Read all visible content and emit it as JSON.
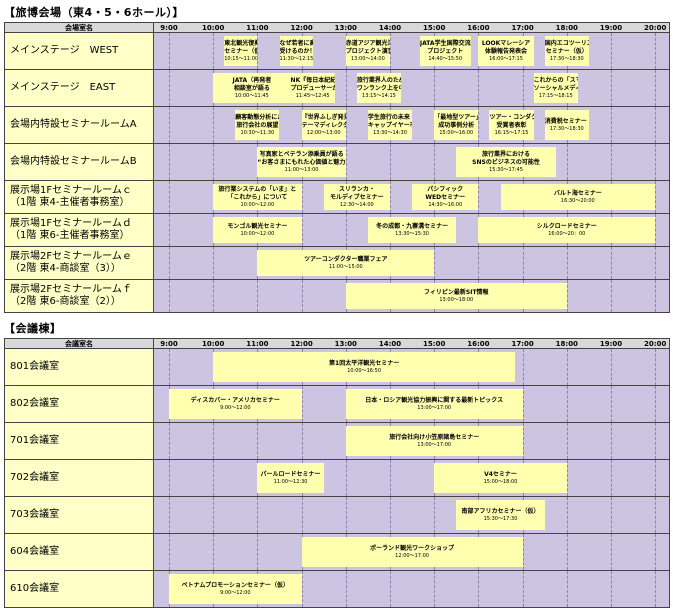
{
  "sections": [
    {
      "title": "【旅博会場（東4・5・6ホール）】",
      "header_label": "会場室名",
      "hours": [
        "9:00",
        "10:00",
        "11:00",
        "12:00",
        "13:00",
        "14:00",
        "15:00",
        "16:00",
        "17:00",
        "18:00",
        "19:00",
        "20:00"
      ],
      "rows": [
        {
          "room": "メインステージ　WEST",
          "events": [
            {
              "title": "東北観光復興\nセミナー（仮）",
              "time": "10:15～11:00",
              "start": 10.25,
              "end": 11.0
            },
            {
              "title": "なぜ若者に高速バスが\n受けるのか！",
              "time": "11:30～12:15",
              "start": 11.5,
              "end": 12.25
            },
            {
              "title": "赤道アジア観光活性化\nプロジェクト演習発表",
              "time": "13:00～14:00",
              "start": 13.0,
              "end": 14.0
            },
            {
              "title": "JATA学生国際交流\nプロジェクト",
              "time": "14:40～15:50",
              "start": 14.67,
              "end": 15.83
            },
            {
              "title": "LOOKマレーシア\n体験報告発表会",
              "time": "16:00～17:15",
              "start": 16.0,
              "end": 17.25
            },
            {
              "title": "国内エコツーリズム\nセミナー（仮）",
              "time": "17:30～18:30",
              "start": 17.5,
              "end": 18.5
            }
          ]
        },
        {
          "room": "メインステージ　EAST",
          "events": [
            {
              "title": "JATA（再発者\n相談室が語る",
              "time": "10:00～11:45",
              "start": 10.0,
              "end": 11.75
            },
            {
              "title": "NK『毎日本紀紀伝』\nプロデューサーが語る",
              "time": "11:45～12:45",
              "start": 11.75,
              "end": 12.75
            },
            {
              "title": "旅行業界人のための\nワンランク上を中「写真セミナー",
              "time": "13:15～14:15",
              "start": 13.25,
              "end": 14.25
            },
            {
              "title": "これからの「スマホ×位置情報×\nソーシャルメディア」マーケティング",
              "time": "17:15～18:15",
              "start": 17.25,
              "end": 18.25
            }
          ]
        },
        {
          "room": "会場内特設セミナールームA",
          "events": [
            {
              "title": "顧客動態分析における\n旅行会社の展望",
              "time": "10:30～11:30",
              "start": 10.5,
              "end": 11.5
            },
            {
              "title": "『世界ふしぎ発見！』\nテーマディレクターが語る",
              "time": "12:00～13:00",
              "start": 12.0,
              "end": 13.0
            },
            {
              "title": "学生旅行の未来（変わる\nキャップイヤー市場に挑もう）",
              "time": "13:30～14:30",
              "start": 13.5,
              "end": 14.5
            },
            {
              "title": "「最地型ツアー」\n成功事例分析",
              "time": "15:00～16:00",
              "start": 15.0,
              "end": 16.0
            },
            {
              "title": "ツアー・コンダクター・オブ・ザ・イヤー\n受賞者表彰",
              "time": "16:15～17:15",
              "start": 16.25,
              "end": 17.25
            },
            {
              "title": "消費税セミナー（仮）",
              "time": "17:30～18:30",
              "start": 17.5,
              "end": 18.5
            }
          ]
        },
        {
          "room": "会場内特設セミナールームB",
          "events": [
            {
              "title": "写真家とペテラン添乗員が語る\n“お客さまにもれた心価値と魅力の一端”",
              "time": "11:00～13:00",
              "start": 11.0,
              "end": 13.0
            },
            {
              "title": "旅行業界における\nSNSのビジネスの可能性",
              "time": "15:30～17:45",
              "start": 15.5,
              "end": 17.75
            }
          ]
        },
        {
          "room": "展示場1Fセミナールームｃ\n（1階 東4-主催者事務室）",
          "events": [
            {
              "title": "旅行業システムの「いま」と\n「これから」について",
              "time": "10:00～12:00",
              "start": 10.0,
              "end": 12.0
            },
            {
              "title": "スリランカ・\nモルディブセミナー",
              "time": "12:30～14:00",
              "start": 12.5,
              "end": 14.0
            },
            {
              "title": "パシフィック\nWEDセミナー",
              "time": "14:30～16:00",
              "start": 14.5,
              "end": 16.0
            },
            {
              "title": "バルト海セミナー",
              "time": "16:30～20:00",
              "start": 16.5,
              "end": 20.0
            }
          ]
        },
        {
          "room": "展示場1Fセミナールームｄ\n（1階 東6-主催者事務室）",
          "events": [
            {
              "title": "モンゴル観光セミナー",
              "time": "10:00～12:00",
              "start": 10.0,
              "end": 12.0
            },
            {
              "title": "冬の成都・九寨溝セミナー",
              "time": "13:30～15:30",
              "start": 13.5,
              "end": 15.5
            },
            {
              "title": "シルクロードセミナー",
              "time": "16:00～20：00",
              "start": 16.0,
              "end": 20.0
            }
          ]
        },
        {
          "room": "展示場2Fセミナールームｅ\n（2階 東4-商談室（3））",
          "events": [
            {
              "title": "ツアーコンダクター職業フェア",
              "time": "11:00～15:00",
              "start": 11.0,
              "end": 15.0
            }
          ]
        },
        {
          "room": "展示場2Fセミナールームｆ\n（2階 東6-商談室（2））",
          "events": [
            {
              "title": "フィリピン最新SIT情報",
              "time": "13:00～18:00",
              "start": 13.0,
              "end": 18.0
            }
          ]
        }
      ]
    },
    {
      "title": "【会議棟】",
      "header_label": "会議室名",
      "hours": [
        "9:00",
        "10:00",
        "11:00",
        "12:00",
        "13:00",
        "14:00",
        "15:00",
        "16:00",
        "17:00",
        "18:00",
        "19:00",
        "20:00"
      ],
      "rows": [
        {
          "room": "801会議室",
          "events": [
            {
              "title": "第1回太平洋観光セミナー",
              "time": "10:00～16:50",
              "start": 10.0,
              "end": 16.83
            }
          ]
        },
        {
          "room": "802会議室",
          "events": [
            {
              "title": "ディスカバー・アメリカセミナー",
              "time": "9:00～12:00",
              "start": 9.0,
              "end": 12.0
            },
            {
              "title": "日本・ロシア観光協力振興に関する最新トピックス",
              "time": "13:00～17:00",
              "start": 13.0,
              "end": 17.0
            }
          ]
        },
        {
          "room": "701会議室",
          "events": [
            {
              "title": "旅行会社向け小笠原諸島セミナー",
              "time": "13:00～17:00",
              "start": 13.0,
              "end": 17.0
            }
          ]
        },
        {
          "room": "702会議室",
          "events": [
            {
              "title": "パールロードセミナー",
              "time": "11:00～12:30",
              "start": 11.0,
              "end": 12.5
            },
            {
              "title": "V4セミナー",
              "time": "15:00～18:00",
              "start": 15.0,
              "end": 18.0
            }
          ]
        },
        {
          "room": "703会議室",
          "events": [
            {
              "title": "南部アフリカセミナー（仮）",
              "time": "15:30～17:30",
              "start": 15.5,
              "end": 17.5
            }
          ]
        },
        {
          "room": "604会議室",
          "events": [
            {
              "title": "ポーランド観光ワークショップ",
              "time": "12:00～17:00",
              "start": 12.0,
              "end": 17.0
            }
          ]
        },
        {
          "room": "610会議室",
          "events": [
            {
              "title": "ベトナムプロモーションセミナー（仮）",
              "time": "9:00～12:00",
              "start": 9.0,
              "end": 12.0
            }
          ]
        }
      ]
    }
  ]
}
